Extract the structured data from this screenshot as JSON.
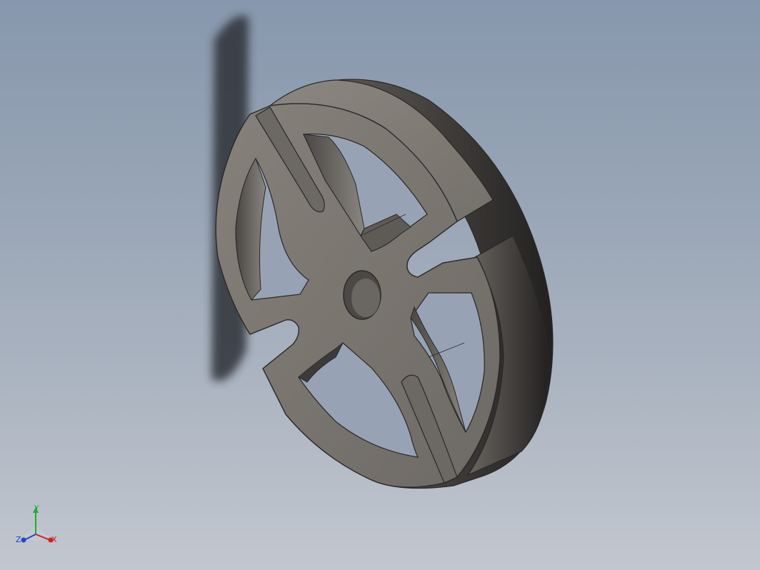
{
  "viewport": {
    "background_top": "#8797ad",
    "background_bottom": "#c2c7cf"
  },
  "part": {
    "description_name": "slotted-disc-with-center-hole",
    "face_color": "#7e7a74",
    "side_color": "#5f5c57",
    "edge_color": "#2a2826",
    "shadow_color": "#2e3338"
  },
  "triad": {
    "x_label": "X",
    "y_label": "Y",
    "z_label": "Z",
    "x_color": "#d32020",
    "y_color": "#1fa83a",
    "z_color": "#2444c8"
  }
}
